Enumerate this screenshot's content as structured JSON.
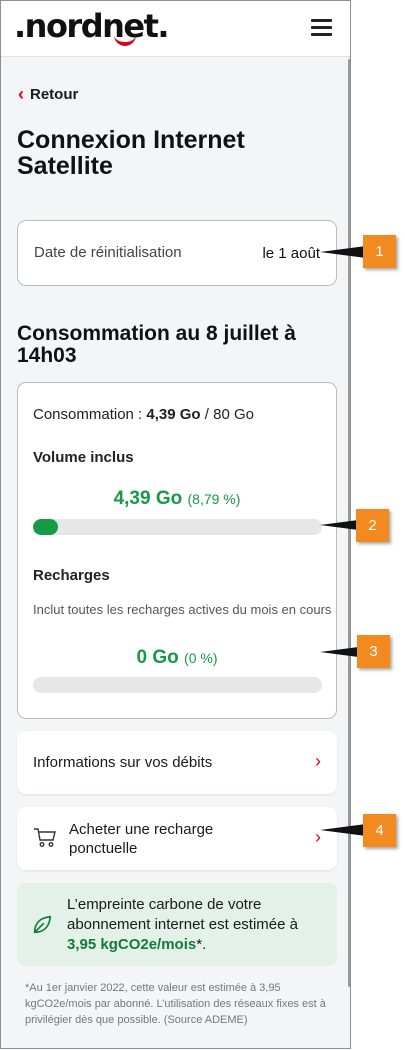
{
  "header": {
    "logo": ".nordnet.",
    "menu_icon": "hamburger-menu-icon"
  },
  "nav": {
    "back_label": "Retour"
  },
  "page": {
    "title": "Connexion Internet Satellite"
  },
  "reset": {
    "label": "Date de réinitialisation",
    "value": "le 1 août"
  },
  "consumption": {
    "title": "Consommation au 8 juillet à 14h03",
    "summary_label": "Consommation : ",
    "used": "4,39 Go",
    "separator": " / ",
    "total": "80 Go",
    "included": {
      "heading": "Volume inclus",
      "amount": "4,39 Go",
      "percent": "(8,79 %)",
      "fill_percent": 8.79
    },
    "recharges": {
      "heading": "Recharges",
      "note": "Inclut toutes les recharges actives du mois en cours",
      "amount": "0 Go",
      "percent": "(0 %)",
      "fill_percent": 0
    }
  },
  "links": {
    "debits": "Informations sur vos débits",
    "recharge": "Acheter une recharge ponctuelle"
  },
  "eco": {
    "text_before": "L’empreinte carbone de votre abonnement internet est estimée à ",
    "value": "3,95 kgCO2e/mois",
    "text_after": "*."
  },
  "footnote": "*Au 1er janvier 2022, cette valeur est estimée à 3,95 kgCO2e/mois par abonné. L’utilisation des réseaux fixes est à privilégier dès que possible. (Source ADEME)",
  "callouts": [
    "1",
    "2",
    "3",
    "4"
  ],
  "colors": {
    "accent_red": "#e2001a",
    "green": "#159a45",
    "callout_orange": "#f28a1f"
  }
}
